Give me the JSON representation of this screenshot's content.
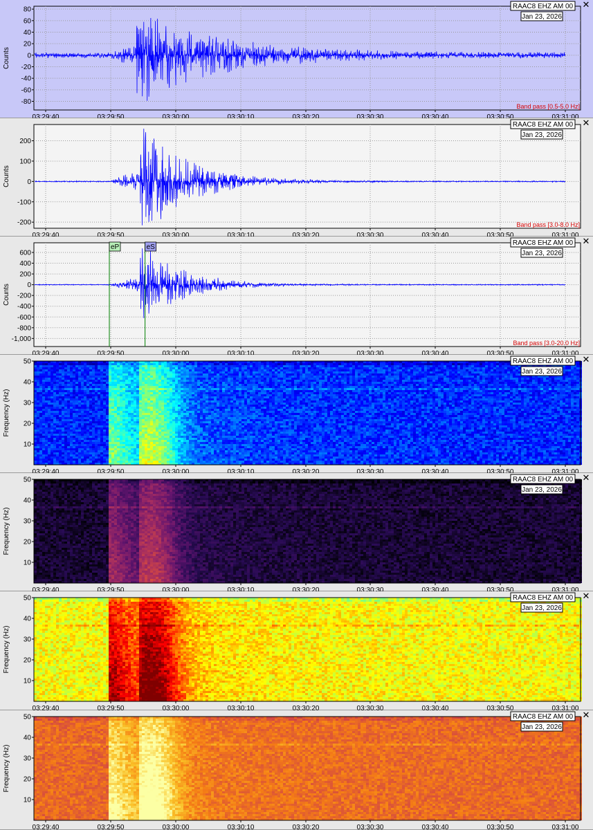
{
  "station": "RAAC8 EHZ AM 00",
  "date": "Jan 23, 2026",
  "close_glyph": "✕",
  "x_ticks": [
    "03:29:40",
    "03:29:50",
    "03:30:00",
    "03:30:10",
    "03:30:20",
    "03:30:30",
    "03:30:40",
    "03:30:50",
    "03:31:00"
  ],
  "colors": {
    "trace": "#0000ff",
    "pick_line": "#008000",
    "filter_text": "#d40000"
  },
  "chart_data": [
    {
      "type": "line",
      "panel": "waveform-1",
      "ylabel": "Counts",
      "ylim": [
        -95,
        85
      ],
      "y_ticks": [
        "80",
        "60",
        "40",
        "20",
        "0",
        "-20",
        "-40",
        "-60",
        "-80"
      ],
      "y_tick_values": [
        80,
        60,
        40,
        20,
        0,
        -20,
        -40,
        -60,
        -80
      ],
      "filter": "Band pass [0.5-5.0 Hz]",
      "background": "#c8c8f8",
      "noise_amp": 5,
      "peak_amp": 80,
      "onset_s": 10,
      "peak_s": 15,
      "decay_s": 12
    },
    {
      "type": "line",
      "panel": "waveform-2",
      "ylabel": "Counts",
      "ylim": [
        -230,
        280
      ],
      "y_ticks": [
        "200",
        "100",
        "0",
        "-100",
        "-200"
      ],
      "y_tick_values": [
        200,
        100,
        0,
        -100,
        -200
      ],
      "filter": "Band pass [3.0-8.0 Hz]",
      "background": "#f4f4f4",
      "noise_amp": 3,
      "peak_amp": 270,
      "onset_s": 10,
      "peak_s": 15.5,
      "decay_s": 7
    },
    {
      "type": "line",
      "panel": "waveform-3",
      "ylabel": "Counts",
      "ylim": [
        -1150,
        780
      ],
      "y_ticks": [
        "600",
        "400",
        "200",
        "0",
        "-200",
        "-400",
        "-600",
        "-800",
        "-1,000"
      ],
      "y_tick_values": [
        600,
        400,
        200,
        0,
        -200,
        -400,
        -600,
        -800,
        -1000
      ],
      "filter": "Band pass [3.0-20.0 Hz]",
      "background": "#f4f4f4",
      "noise_amp": 10,
      "peak_amp": 750,
      "onset_s": 10,
      "peak_s": 15.5,
      "decay_s": 6,
      "picks": [
        {
          "label": "eP",
          "time_s": 9.8,
          "color": "#b8f0b8"
        },
        {
          "label": "eS",
          "time_s": 15.3,
          "color": "#a0a0f0"
        }
      ]
    },
    {
      "type": "heatmap",
      "panel": "spectrogram-jet",
      "ylabel": "Frequency (Hz)",
      "ylim": [
        0,
        50
      ],
      "y_ticks": [
        "50",
        "40",
        "30",
        "20",
        "10"
      ],
      "y_tick_values": [
        50,
        40,
        30,
        20,
        10
      ],
      "colormap": "jet",
      "base": 0.16,
      "onset_s": 9.5,
      "peak_s": 15.5,
      "line_hz": 37
    },
    {
      "type": "heatmap",
      "panel": "spectrogram-inferno",
      "ylabel": "Frequency (Hz)",
      "ylim": [
        0,
        50
      ],
      "y_ticks": [
        "50",
        "40",
        "30",
        "20",
        "10"
      ],
      "y_tick_values": [
        50,
        40,
        30,
        20,
        10
      ],
      "colormap": "inferno",
      "base": 0.08,
      "onset_s": 9.5,
      "peak_s": 15.5,
      "line_hz": 37
    },
    {
      "type": "heatmap",
      "panel": "spectrogram-jet-enhanced",
      "ylabel": "Frequency (Hz)",
      "ylim": [
        0,
        50
      ],
      "y_ticks": [
        "50",
        "40",
        "30",
        "20",
        "10"
      ],
      "y_tick_values": [
        50,
        40,
        30,
        20,
        10
      ],
      "colormap": "jet",
      "base": 0.62,
      "onset_s": 9.5,
      "peak_s": 15.5,
      "line_hz": 37
    },
    {
      "type": "heatmap",
      "panel": "spectrogram-inferno-enhanced",
      "ylabel": "Frequency (Hz)",
      "ylim": [
        0,
        50
      ],
      "y_ticks": [
        "50",
        "40",
        "30",
        "20",
        "10"
      ],
      "y_tick_values": [
        50,
        40,
        30,
        20,
        10
      ],
      "colormap": "inferno",
      "base": 0.66,
      "onset_s": 9.5,
      "peak_s": 15.5,
      "line_hz": 37
    }
  ]
}
